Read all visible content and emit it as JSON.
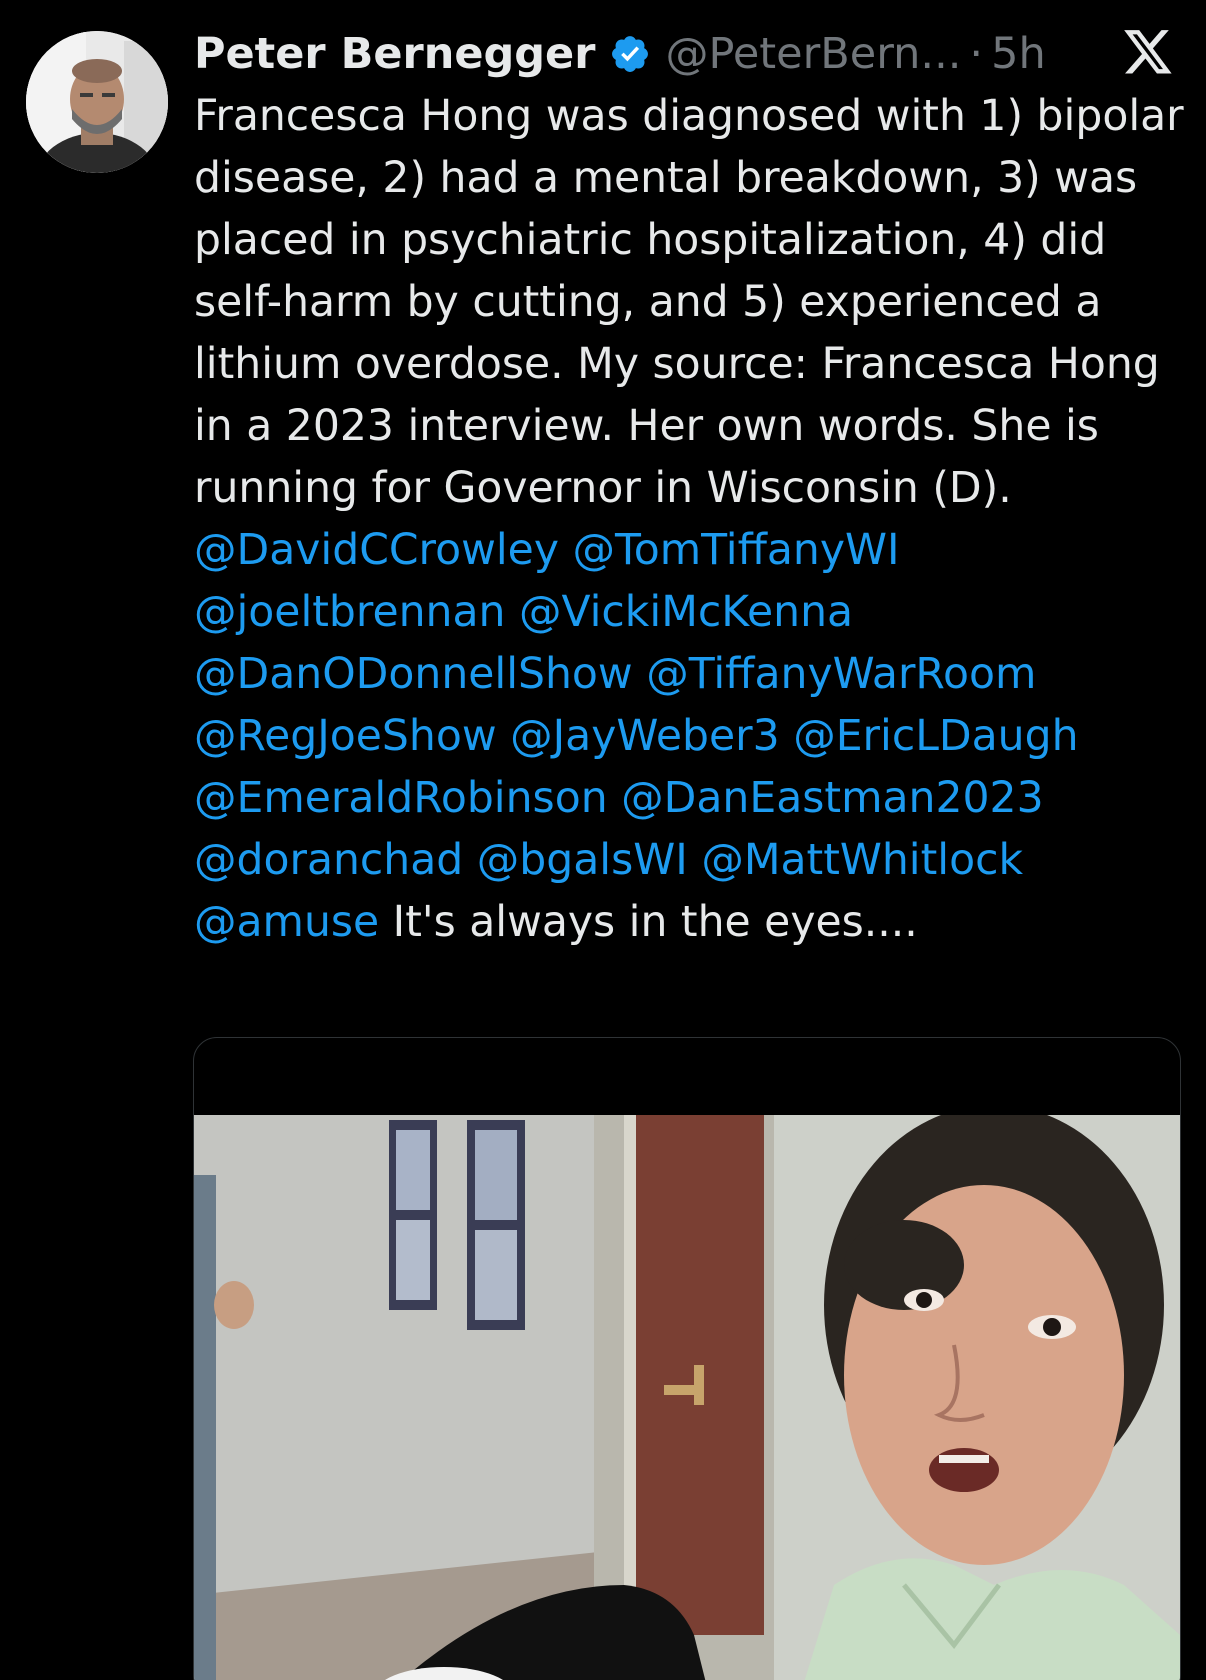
{
  "tweet": {
    "author": {
      "display_name": "Peter Bernegger",
      "handle": "@PeterBern...",
      "verified": true
    },
    "separator": "·",
    "time": "5h",
    "text_segments": [
      {
        "type": "text",
        "value": "Francesca Hong was diagnosed with 1) bipolar disease, 2) had a mental breakdown, 3) was placed in psychiatric hospitalization, 4) did self-harm by cutting, and 5) experienced a lithium overdose. My source: Francesca Hong in a 2023 interview. Her own words. She is running for Governor in Wisconsin (D). "
      },
      {
        "type": "mention",
        "value": "@DavidCCrowley"
      },
      {
        "type": "text",
        "value": " "
      },
      {
        "type": "mention",
        "value": "@TomTiffanyWI"
      },
      {
        "type": "text",
        "value": " "
      },
      {
        "type": "mention",
        "value": "@joeltbrennan"
      },
      {
        "type": "text",
        "value": " "
      },
      {
        "type": "mention",
        "value": "@VickiMcKenna"
      },
      {
        "type": "text",
        "value": " "
      },
      {
        "type": "mention",
        "value": "@DanODonnellShow"
      },
      {
        "type": "text",
        "value": " "
      },
      {
        "type": "mention",
        "value": "@TiffanyWarRoom"
      },
      {
        "type": "text",
        "value": " "
      },
      {
        "type": "mention",
        "value": "@RegJoeShow"
      },
      {
        "type": "text",
        "value": " "
      },
      {
        "type": "mention",
        "value": "@JayWeber3"
      },
      {
        "type": "text",
        "value": " "
      },
      {
        "type": "mention",
        "value": "@EricLDaugh"
      },
      {
        "type": "text",
        "value": " "
      },
      {
        "type": "mention",
        "value": "@EmeraldRobinson"
      },
      {
        "type": "text",
        "value": " "
      },
      {
        "type": "mention",
        "value": "@DanEastman2023"
      },
      {
        "type": "text",
        "value": " "
      },
      {
        "type": "mention",
        "value": "@doranchad"
      },
      {
        "type": "text",
        "value": " "
      },
      {
        "type": "mention",
        "value": "@bgalsWI"
      },
      {
        "type": "text",
        "value": " "
      },
      {
        "type": "mention",
        "value": "@MattWhitlock"
      },
      {
        "type": "text",
        "value": " "
      },
      {
        "type": "mention",
        "value": "@amuse"
      },
      {
        "type": "text",
        "value": " It's always in the eyes...."
      }
    ]
  },
  "icons": {
    "verified": "verified-badge-icon",
    "platform": "x-logo-icon"
  },
  "colors": {
    "background": "#000000",
    "text_primary": "#e7e9ea",
    "text_secondary": "#71767b",
    "accent": "#1d9bf0",
    "card_border": "#2f3336"
  }
}
